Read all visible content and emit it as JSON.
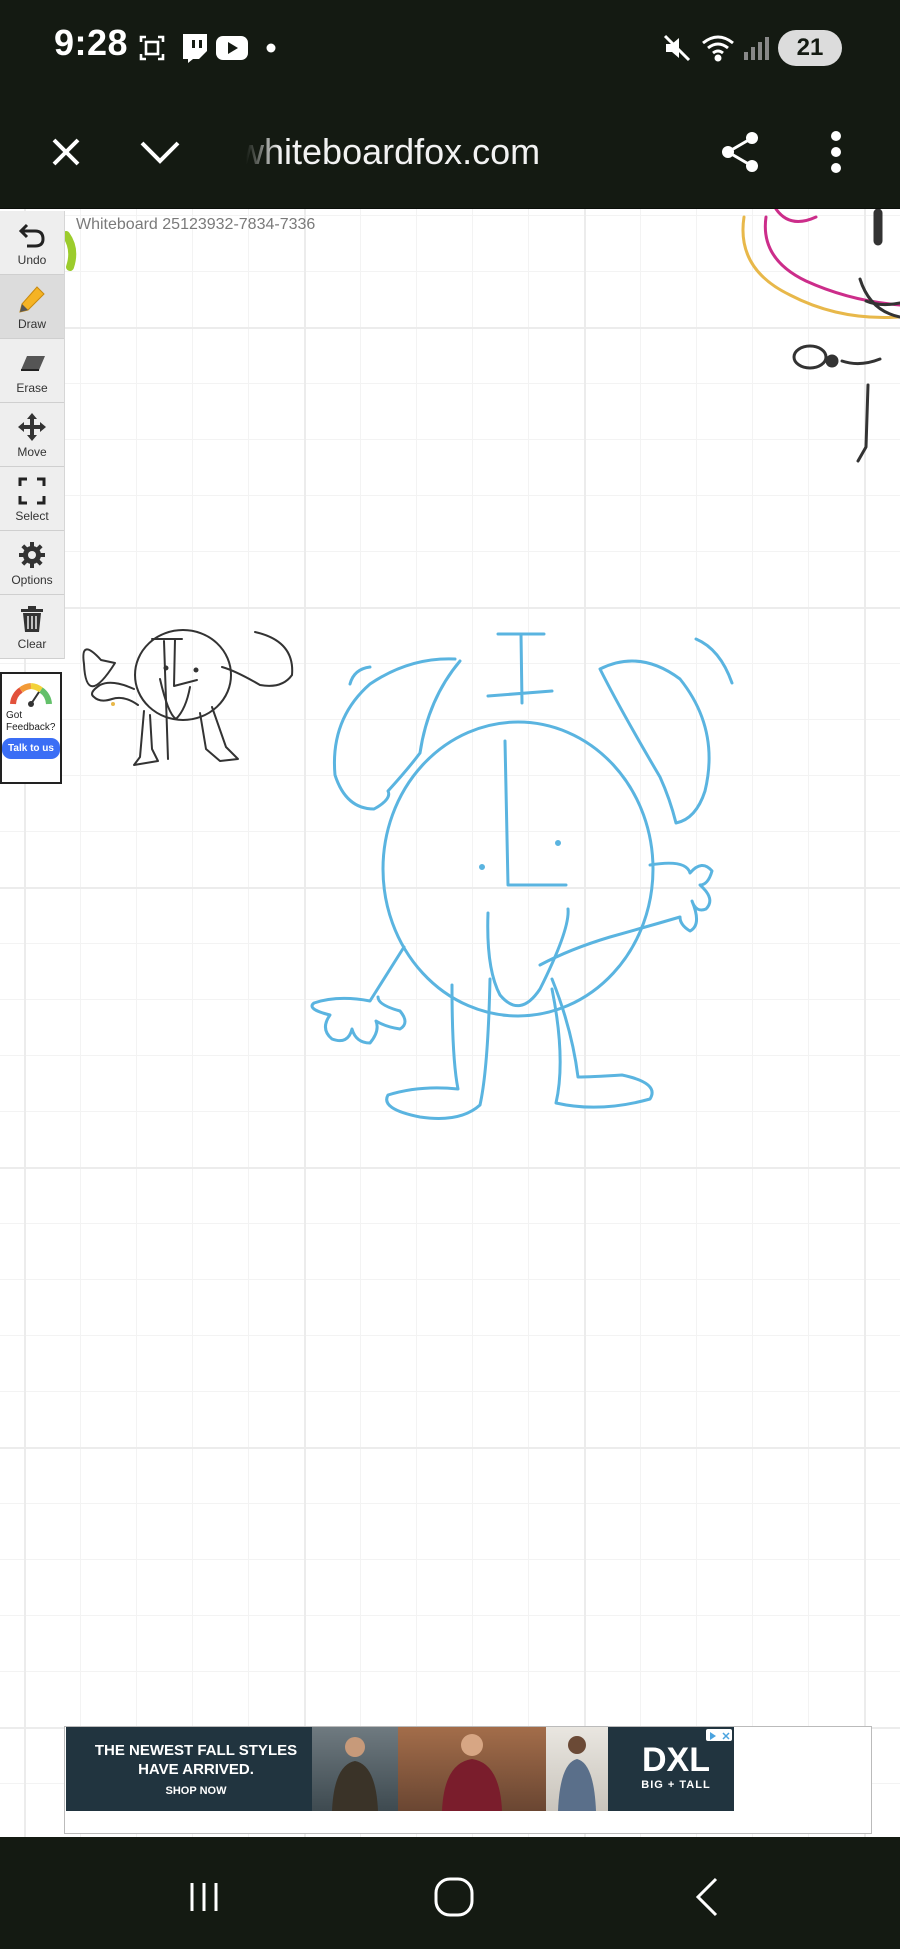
{
  "status_bar": {
    "time": "9:28",
    "icons": [
      "screenshot-icon",
      "twitch-icon",
      "youtube-icon",
      "notification-dot-icon",
      "mute-icon",
      "wifi-icon",
      "signal-icon"
    ],
    "battery": "21"
  },
  "browser": {
    "url": "whiteboardfox.com",
    "icons": [
      "close-icon",
      "chevron-down-icon",
      "share-icon",
      "more-vert-icon"
    ]
  },
  "whiteboard": {
    "title": "Whiteboard 25123932-7834-7336",
    "stroke_colors": {
      "blue": "#5ab4e0",
      "black": "#222222",
      "yellow": "#e8b84a",
      "magenta": "#cc2d8a",
      "green": "#9ccc2c"
    }
  },
  "toolbar": {
    "tools": [
      {
        "label": "Undo",
        "icon": "undo-icon"
      },
      {
        "label": "Draw",
        "icon": "pencil-icon",
        "active": true
      },
      {
        "label": "Erase",
        "icon": "eraser-icon"
      },
      {
        "label": "Move",
        "icon": "move-icon"
      },
      {
        "label": "Select",
        "icon": "select-icon"
      },
      {
        "label": "Options",
        "icon": "gear-icon"
      },
      {
        "label": "Clear",
        "icon": "trash-icon"
      }
    ],
    "feedback": {
      "text": "Got Feedback?",
      "button": "Talk to us",
      "icon": "gauge-icon"
    }
  },
  "ad": {
    "headline": "THE NEWEST FALL STYLES HAVE ARRIVED.",
    "cta": "SHOP NOW",
    "brand": "DXL",
    "brand_sub": "BIG + TALL"
  },
  "nav_bar": {
    "icons": [
      "recents-icon",
      "home-icon",
      "back-icon"
    ]
  }
}
